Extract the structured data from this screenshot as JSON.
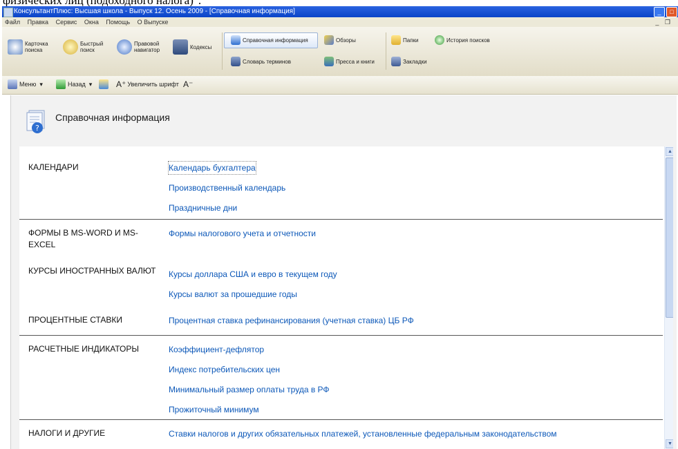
{
  "caption": "физических лиц (подоходного налога)\".",
  "window": {
    "title": "КонсультантПлюс: Высшая школа - Выпуск 12. Осень 2009 - [Справочная информация]",
    "min_label": "_",
    "max_label": "□"
  },
  "menu": {
    "items": [
      "Файл",
      "Правка",
      "Сервис",
      "Окна",
      "Помощь",
      "О Выпуске"
    ],
    "window_controls": "_ ❐"
  },
  "ribbon": {
    "card_search": "Карточка поиска",
    "quick_search": "Быстрый поиск",
    "legal_navigator": "Правовой навигатор",
    "codes": "Кодексы",
    "reference_info": "Справочная информация",
    "reviews": "Обзоры",
    "dictionary": "Словарь терминов",
    "press": "Пресса и книги",
    "folders": "Папки",
    "search_history": "История поисков",
    "bookmarks": "Закладки"
  },
  "toolbar": {
    "menu": "Меню",
    "back": "Назад",
    "zoom": "Увеличить шрифт"
  },
  "page": {
    "title": "Справочная информация"
  },
  "sections": [
    {
      "category": "КАЛЕНДАРИ",
      "links": [
        "Календарь бухгалтера",
        "Производственный календарь",
        "Праздничные дни"
      ]
    },
    {
      "category": "ФОРМЫ В MS-WORD И MS-EXCEL",
      "links": [
        "Формы налогового учета и отчетности"
      ]
    },
    {
      "category": "КУРСЫ ИНОСТРАННЫХ ВАЛЮТ",
      "links": [
        "Курсы доллара США и евро в текущем году",
        "Курсы валют за прошедшие годы"
      ]
    },
    {
      "category": "ПРОЦЕНТНЫЕ СТАВКИ",
      "links": [
        "Процентная ставка рефинансирования (учетная ставка) ЦБ РФ"
      ]
    },
    {
      "category": "РАСЧЕТНЫЕ ИНДИКАТОРЫ",
      "links": [
        "Коэффициент-дефлятор",
        "Индекс потребительских цен",
        "Минимальный размер оплаты труда в РФ",
        "Прожиточный минимум"
      ]
    },
    {
      "category": "НАЛОГИ И ДРУГИЕ",
      "links": [
        "Ставки налогов и других обязательных платежей, установленные федеральным законодательством"
      ]
    }
  ],
  "colors": {
    "link": "#0b57b8",
    "titlebar": "#0a44c8"
  }
}
